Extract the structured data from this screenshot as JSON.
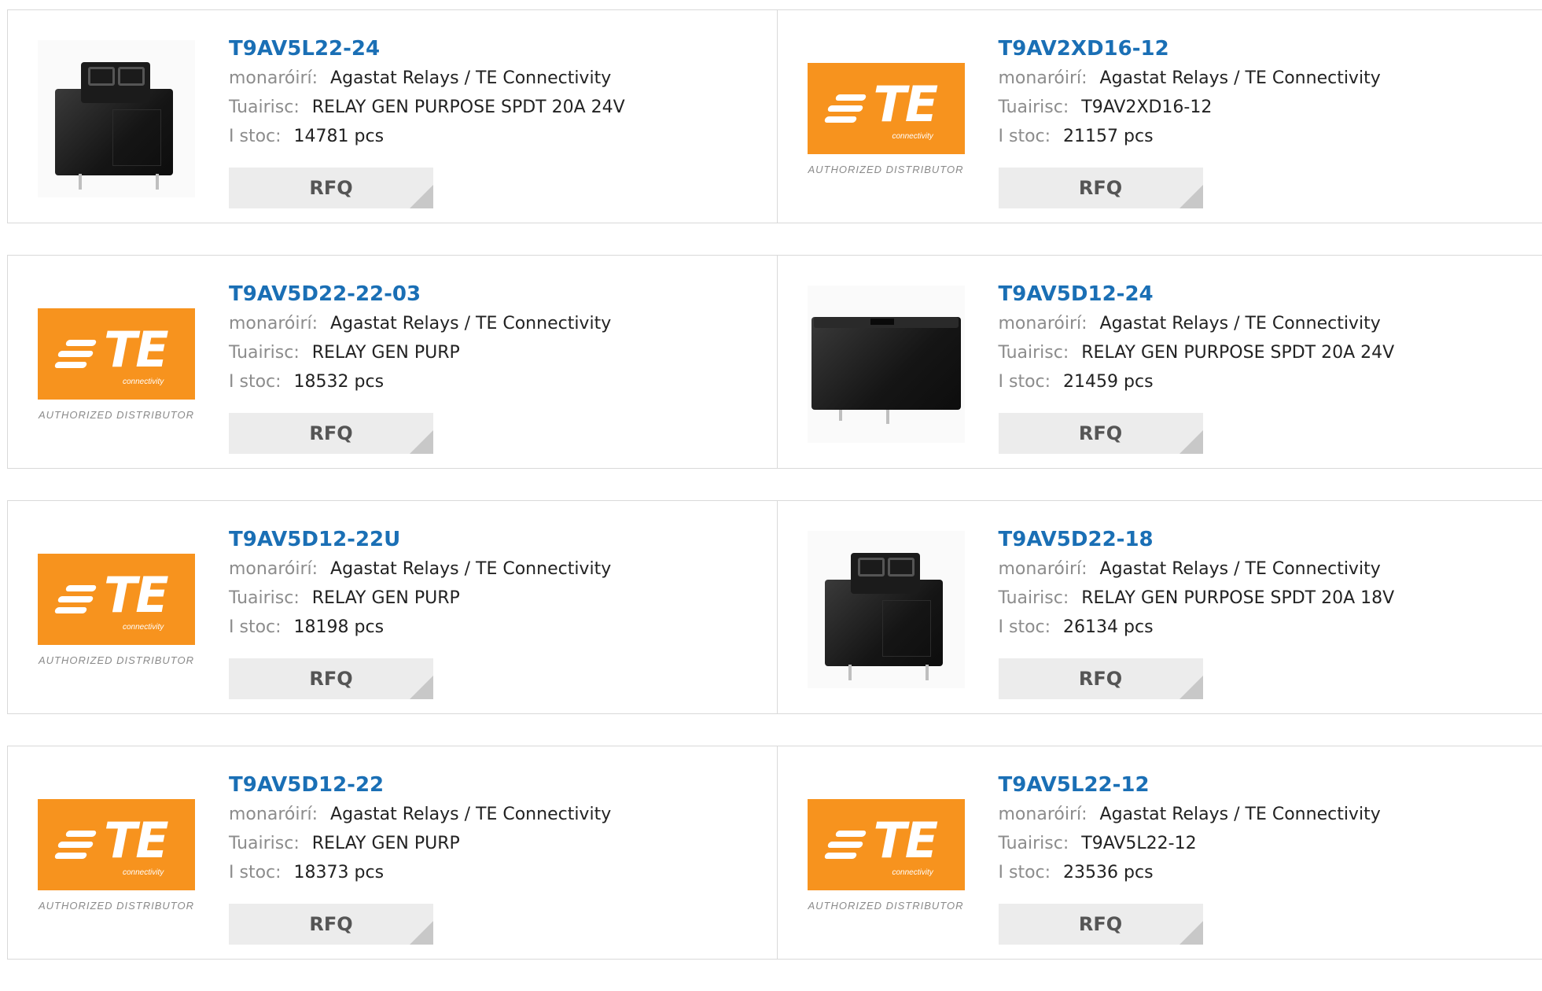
{
  "labels": {
    "manufacturer": "monaróirí:",
    "description": "Tuairisc:",
    "stock": "I stoc:",
    "rfq": "RFQ"
  },
  "logo": {
    "letters": "TE",
    "sub": "connectivity",
    "authorized": "AUTHORIZED DISTRIBUTOR"
  },
  "colors": {
    "link": "#1a6fb5",
    "te_orange": "#f7931e",
    "rfq_bg": "#ececec"
  },
  "products": [
    {
      "part": "T9AV5L22-24",
      "manufacturer": "Agastat Relays / TE Connectivity",
      "description": "RELAY GEN PURPOSE SPDT 20A 24V",
      "stock": "14781 pcs",
      "image": "relay-top-terminal"
    },
    {
      "part": "T9AV2XD16-12",
      "manufacturer": "Agastat Relays / TE Connectivity",
      "description": "T9AV2XD16-12",
      "stock": "21157 pcs",
      "image": "te-logo"
    },
    {
      "part": "T9AV5D22-22-03",
      "manufacturer": "Agastat Relays / TE Connectivity",
      "description": "RELAY GEN PURP",
      "stock": "18532 pcs",
      "image": "te-logo"
    },
    {
      "part": "T9AV5D12-24",
      "manufacturer": "Agastat Relays / TE Connectivity",
      "description": "RELAY GEN PURPOSE SPDT 20A 24V",
      "stock": "21459 pcs",
      "image": "relay-box"
    },
    {
      "part": "T9AV5D12-22U",
      "manufacturer": "Agastat Relays / TE Connectivity",
      "description": "RELAY GEN PURP",
      "stock": "18198 pcs",
      "image": "te-logo"
    },
    {
      "part": "T9AV5D22-18",
      "manufacturer": "Agastat Relays / TE Connectivity",
      "description": "RELAY GEN PURPOSE SPDT 20A 18V",
      "stock": "26134 pcs",
      "image": "relay-top-terminal"
    },
    {
      "part": "T9AV5D12-22",
      "manufacturer": "Agastat Relays / TE Connectivity",
      "description": "RELAY GEN PURP",
      "stock": "18373 pcs",
      "image": "te-logo"
    },
    {
      "part": "T9AV5L22-12",
      "manufacturer": "Agastat Relays / TE Connectivity",
      "description": "T9AV5L22-12",
      "stock": "23536 pcs",
      "image": "te-logo"
    }
  ]
}
